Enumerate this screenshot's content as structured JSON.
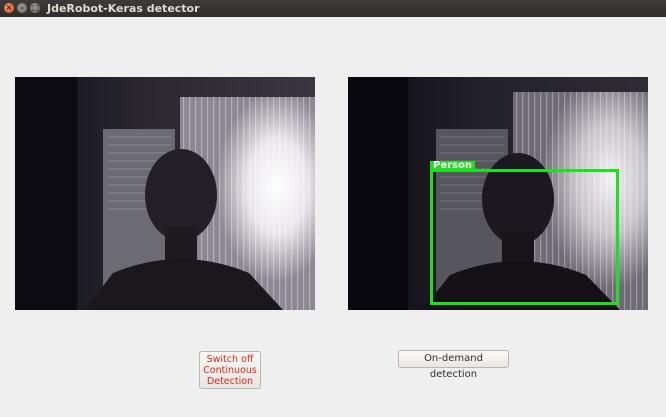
{
  "window": {
    "title": "JdeRobot-Keras detector",
    "controls": {
      "close": "×",
      "minimize": "–",
      "maximize": "□"
    }
  },
  "detection": {
    "label": "Person",
    "box_color": "#1fe01f"
  },
  "buttons": {
    "toggle_label": "Switch off\nContinuous\nDetection",
    "on_demand_label": "On-demand detection"
  },
  "colors": {
    "toggle_text": "#e0281c",
    "window_bg": "#efefef",
    "titlebar_bg": "#3d3c38"
  }
}
